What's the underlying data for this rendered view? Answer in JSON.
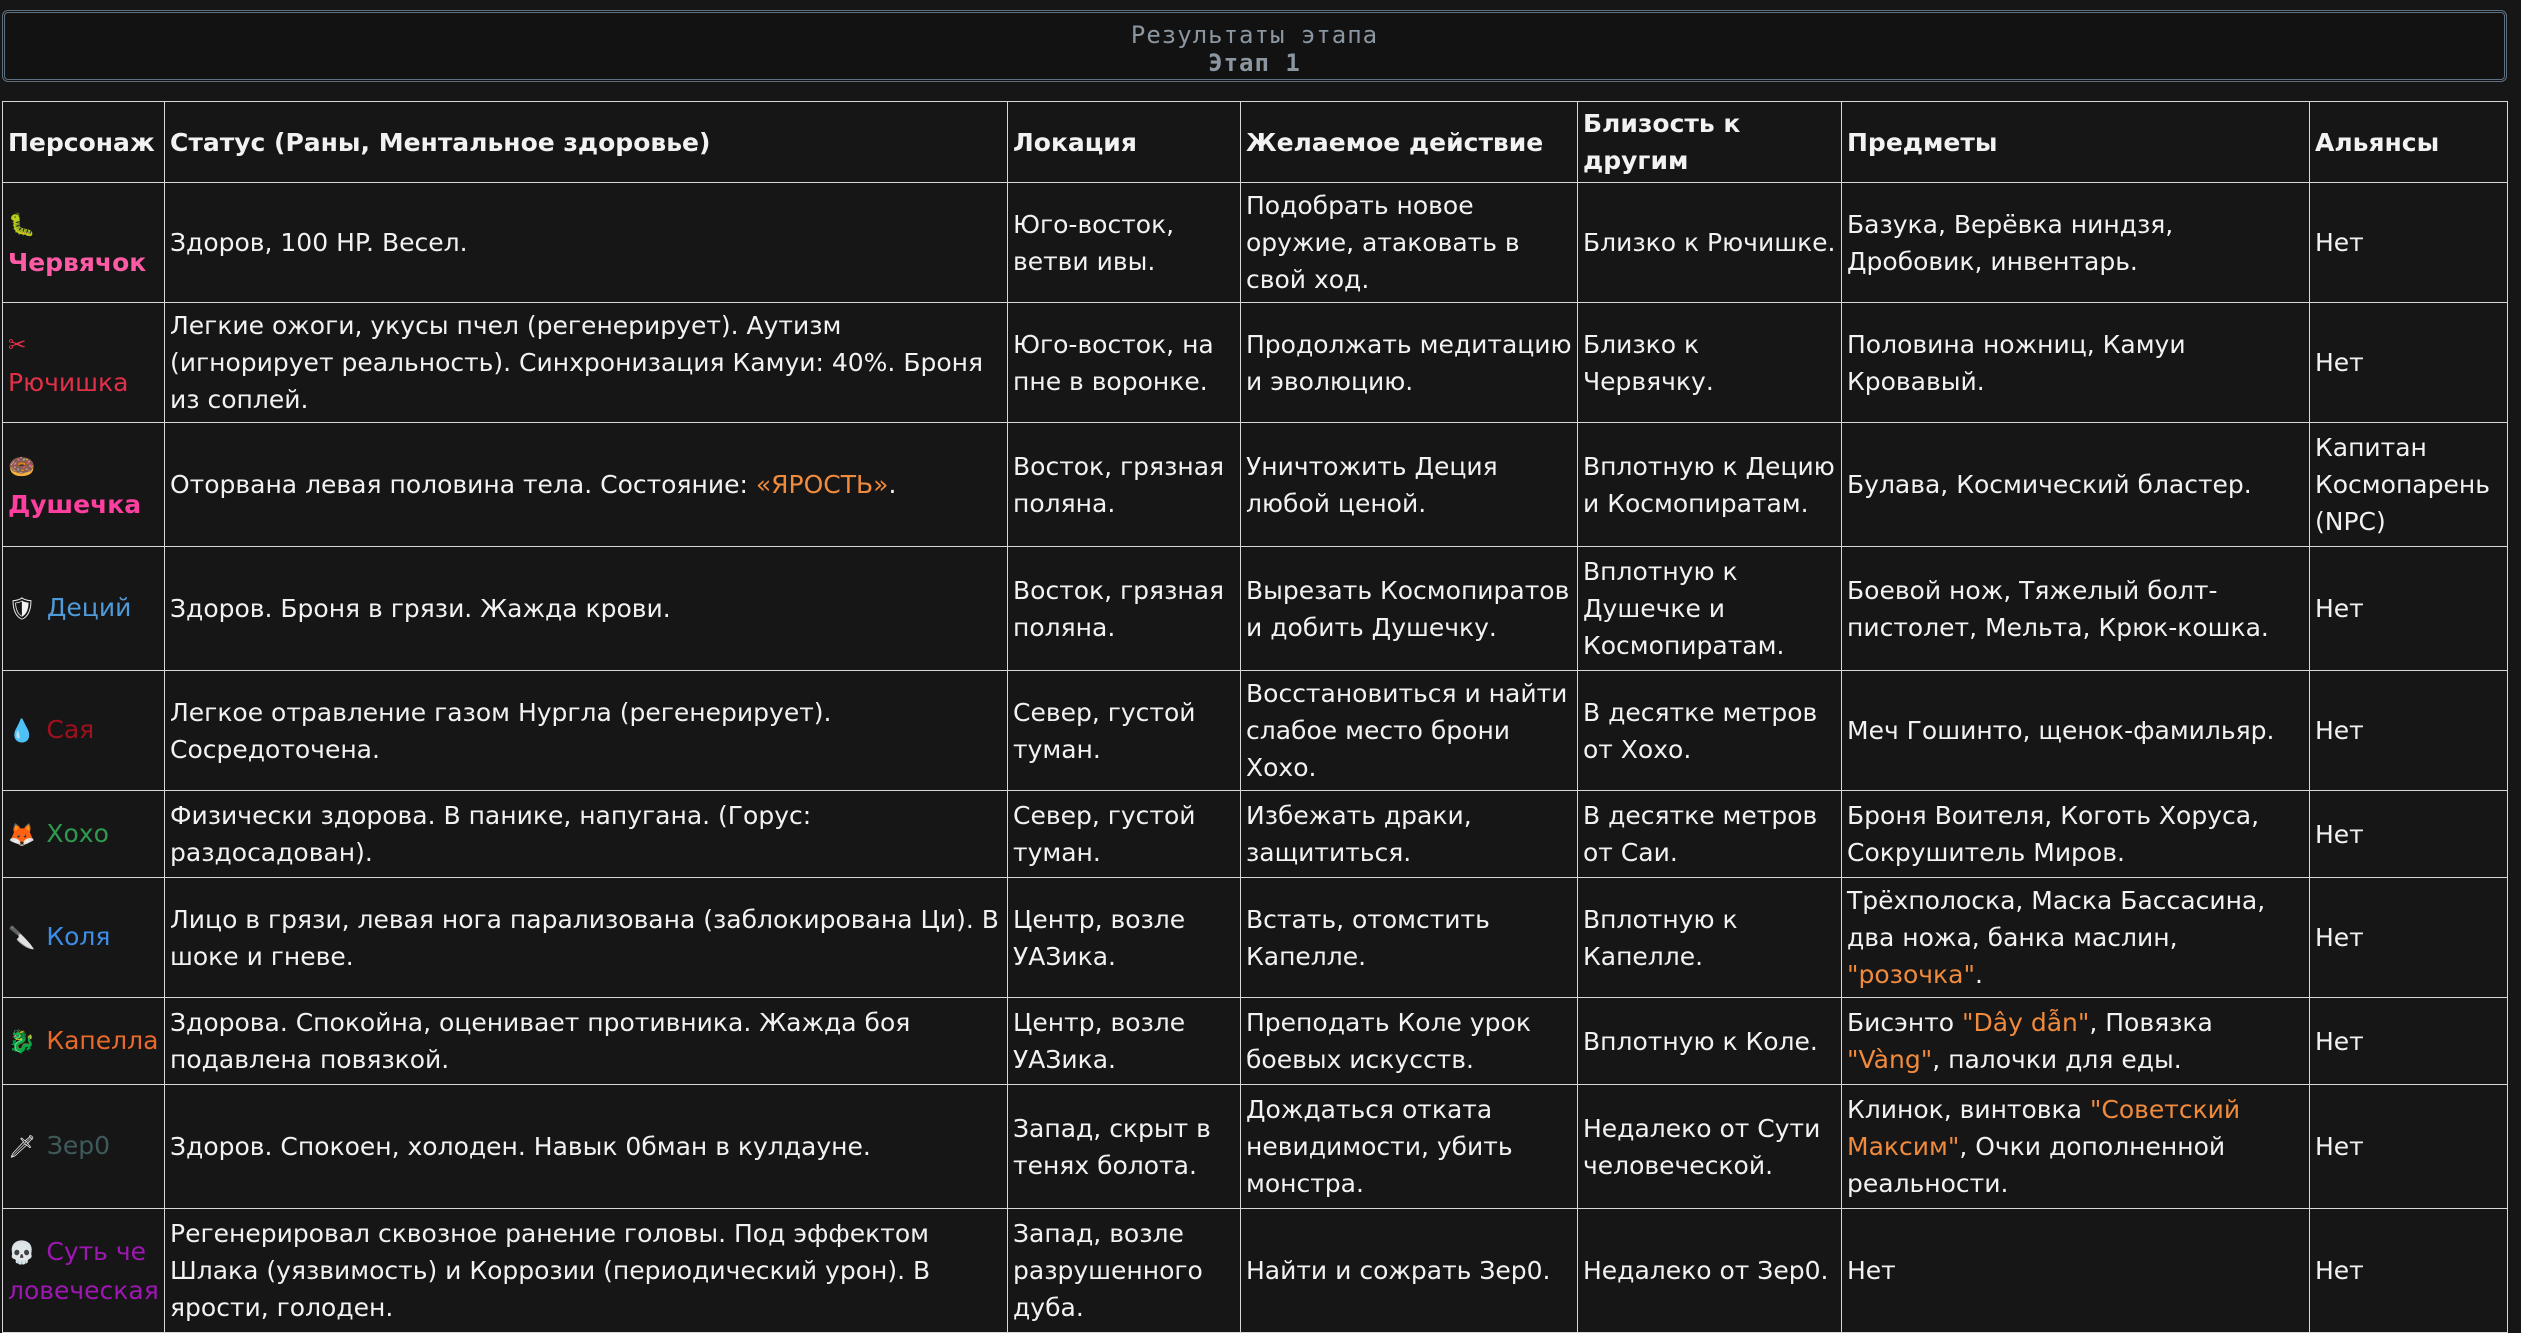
{
  "header": {
    "title": "Результаты этапа",
    "subtitle": "Этап 1"
  },
  "table": {
    "columns": [
      "Персонаж",
      "Статус (Раны, Ментальное здоровье)",
      "Локация",
      "Желаемое действие",
      "Близость к другим",
      "Предметы",
      "Альянсы"
    ],
    "rows": [
      {
        "icon": "🐛",
        "icon_name": "caterpillar-icon",
        "name": "Червячок",
        "name_color": "#ff5aa5",
        "status": "Здоров, 100 HP. Весел.",
        "location": "Юго-восток, ветви ивы.",
        "action": "Подобрать новое оружие, атаковать в свой ход.",
        "proximity": "Близко к Рючишке.",
        "items": "Базука, Верёвка ниндзя, Дробовик, инвентарь.",
        "alliances": "Нет"
      },
      {
        "icon": "✂",
        "icon_name": "scissors-icon",
        "name": "Рючишка",
        "name_color": "#e0304a",
        "status": "Легкие ожоги, укусы пчел (регенерирует). Аутизм (игнорирует реальность). Синхронизация Камуи: 40%. Броня из соплей.",
        "location": "Юго-восток, на пне в воронке.",
        "action": "Продолжать медитацию и эволюцию.",
        "proximity": "Близко к Червячку.",
        "items": "Половина ножниц, Камуи Кровавый.",
        "alliances": "Нет"
      },
      {
        "icon": "🍩",
        "icon_name": "donut-icon",
        "name": "Душечка",
        "name_color": "#ff3fa0",
        "status_before": "Оторвана левая половина тела. Состояние: ",
        "status_hl": "«ЯРОСТЬ»",
        "status_after": ".",
        "location": "Восток, грязная поляна.",
        "action": "Уничтожить Деция любой ценой.",
        "proximity": "Вплотную к Децию и Космопиратам.",
        "items": "Булава, Космический бластер.",
        "alliances": "Капитан Космопарень (NPC)"
      },
      {
        "icon": "🛡",
        "icon_name": "shield-icon",
        "name": "Деций",
        "name_color": "#4f9ad8",
        "status": "Здоров. Броня в грязи. Жажда крови.",
        "location": "Восток, грязная поляна.",
        "action": "Вырезать Космопиратов и добить Душечку.",
        "proximity": "Вплотную к Душечке и Космопиратам.",
        "items": "Боевой нож, Тяжелый болт-пистолет, Мельта, Крюк-кошка.",
        "alliances": "Нет"
      },
      {
        "icon": "💧",
        "icon_name": "blood-drop-icon",
        "name": "Сая",
        "name_color": "#a0101e",
        "status": "Легкое отравление газом Нургла (регенерирует). Сосредоточена.",
        "location": "Север, густой туман.",
        "action": "Восстановиться и найти слабое место брони Хохо.",
        "proximity": "В десятке метров от Хохо.",
        "items": "Меч Гошинто, щенок-фамильяр.",
        "alliances": "Нет"
      },
      {
        "icon": "🦊",
        "icon_name": "fox-icon",
        "name": "Хохо",
        "name_color": "#2e9a4e",
        "status": "Физически здорова. В панике, напугана. (Горус: раздосадован).",
        "location": "Север, густой туман.",
        "action": "Избежать драки, защититься.",
        "proximity": "В десятке метров от Саи.",
        "items": "Броня Воителя, Коготь Хоруса, Сокрушитель Миров.",
        "alliances": "Нет"
      },
      {
        "icon": "🔪",
        "icon_name": "knife-icon",
        "name": "Коля",
        "name_color": "#3d8de8",
        "status": "Лицо в грязи, левая нога парализована (заблокирована Ци). В шоке и гневе.",
        "location": "Центр, возле УАЗика.",
        "action": "Встать, отомстить Капелле.",
        "proximity": "Вплотную к Капелле.",
        "items_before": "Трёхполоска, Маска Бассасина, два ножа, банка маслин, ",
        "items_hl": "\"розочка\"",
        "items_after": ".",
        "alliances": "Нет"
      },
      {
        "icon": "🐉",
        "icon_name": "dragon-icon",
        "name": "Капелла",
        "name_color": "#e86a2a",
        "status": "Здорова. Спокойна, оценивает противника. Жажда боя подавлена повязкой.",
        "location": "Центр, возле УАЗика.",
        "action": "Преподать Коле урок боевых искусств.",
        "proximity": "Вплотную к Коле.",
        "items_p1": "Бисэнто ",
        "items_h1": "\"Dây dẫn\"",
        "items_p2": ", Повязка ",
        "items_h2": "\"Vàng\"",
        "items_p3": ", палочки для еды.",
        "alliances": "Нет"
      },
      {
        "icon": "🗡",
        "icon_name": "dagger-icon",
        "name": "Зер0",
        "name_color": "#3e5a5a",
        "status": "Здоров. Спокоен, холоден. Навык 0бман в кулдауне.",
        "location": "Запад, скрыт в тенях болота.",
        "action": "Дождаться отката невидимости, убить монстра.",
        "proximity": "Недалеко от Сути человеческой.",
        "items_before": "Клинок, винтовка ",
        "items_hl": "\"Советский Максим\"",
        "items_after": ", Очки дополненной реальности.",
        "alliances": "Нет"
      },
      {
        "icon": "💀",
        "icon_name": "skull-icon",
        "name": "Суть человеческая",
        "name_color": "#a016b4",
        "status": "Регенерировал сквозное ранение головы. Под эффектом Шлака (уязвимость) и Коррозии (периодический урон). В ярости, голоден.",
        "location": "Запад, возле разрушенного дуба.",
        "action": "Найти и сожрать Зер0.",
        "proximity": "Недалеко от Зер0.",
        "items": "Нет",
        "alliances": "Нет"
      }
    ]
  }
}
